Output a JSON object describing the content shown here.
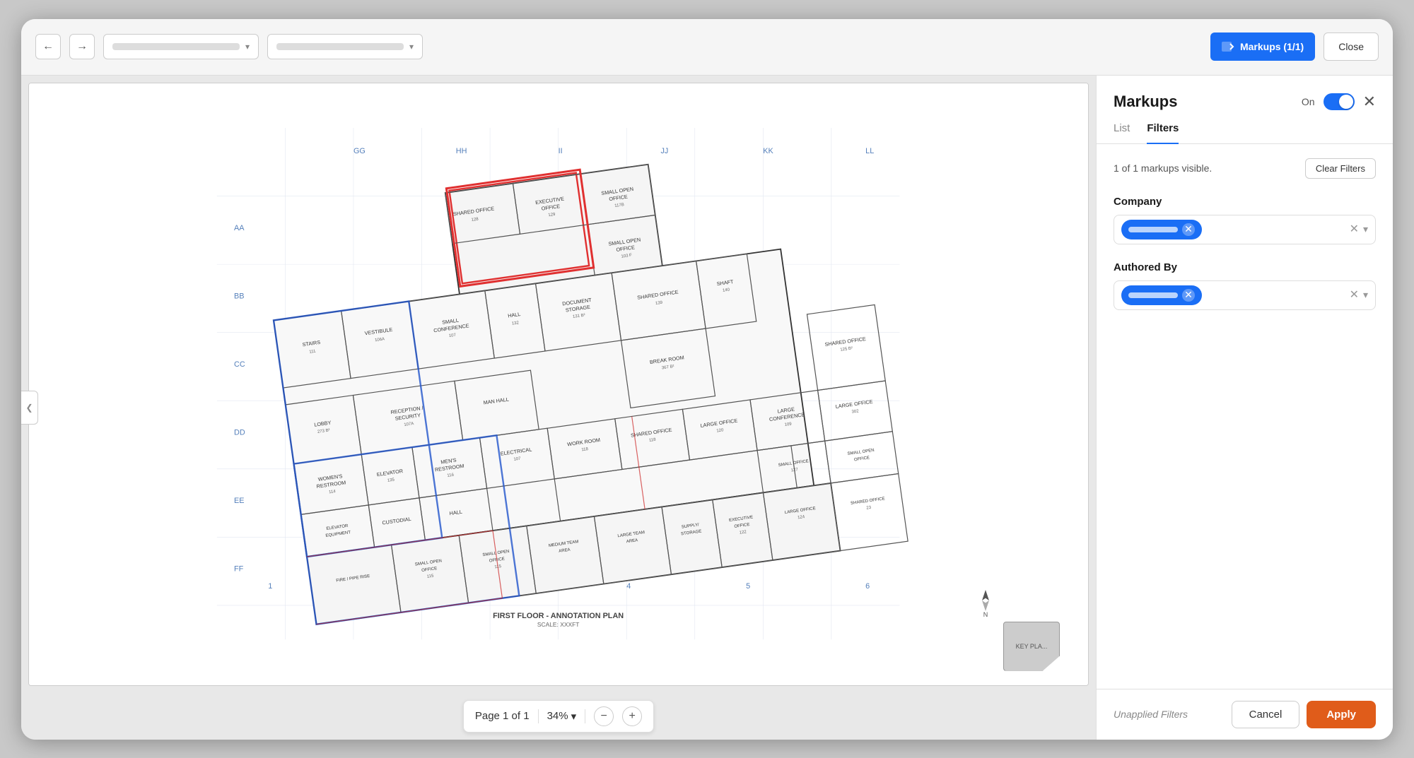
{
  "device": {
    "background_color": "#c8c8c8"
  },
  "topbar": {
    "back_button": "←",
    "forward_button": "→",
    "dropdown1_placeholder": "",
    "dropdown2_placeholder": "",
    "markups_button": "Markups (1/1)",
    "close_button": "Close"
  },
  "viewer": {
    "collapse_icon": "❮",
    "bottom": {
      "page_label": "Page 1 of 1",
      "zoom_level": "34%",
      "zoom_arrow": "▾",
      "zoom_minus": "−",
      "zoom_plus": "+"
    },
    "floor_plan_label": "FIRST FLOOR - ANNOTATION PLAN",
    "key_plan_label": "KEY PLA..."
  },
  "panel": {
    "title": "Markups",
    "toggle_label": "On",
    "tabs": [
      {
        "label": "List",
        "active": false
      },
      {
        "label": "Filters",
        "active": true
      }
    ],
    "visibility_text": "1 of 1 markups visible.",
    "clear_filters_button": "Clear Filters",
    "company_filter": {
      "label": "Company",
      "chip_label": "",
      "has_chip": true
    },
    "authored_by_filter": {
      "label": "Authored By",
      "chip_label": "",
      "has_chip": true
    },
    "footer": {
      "unapplied_text": "Unapplied Filters",
      "cancel_button": "Cancel",
      "apply_button": "Apply"
    }
  }
}
